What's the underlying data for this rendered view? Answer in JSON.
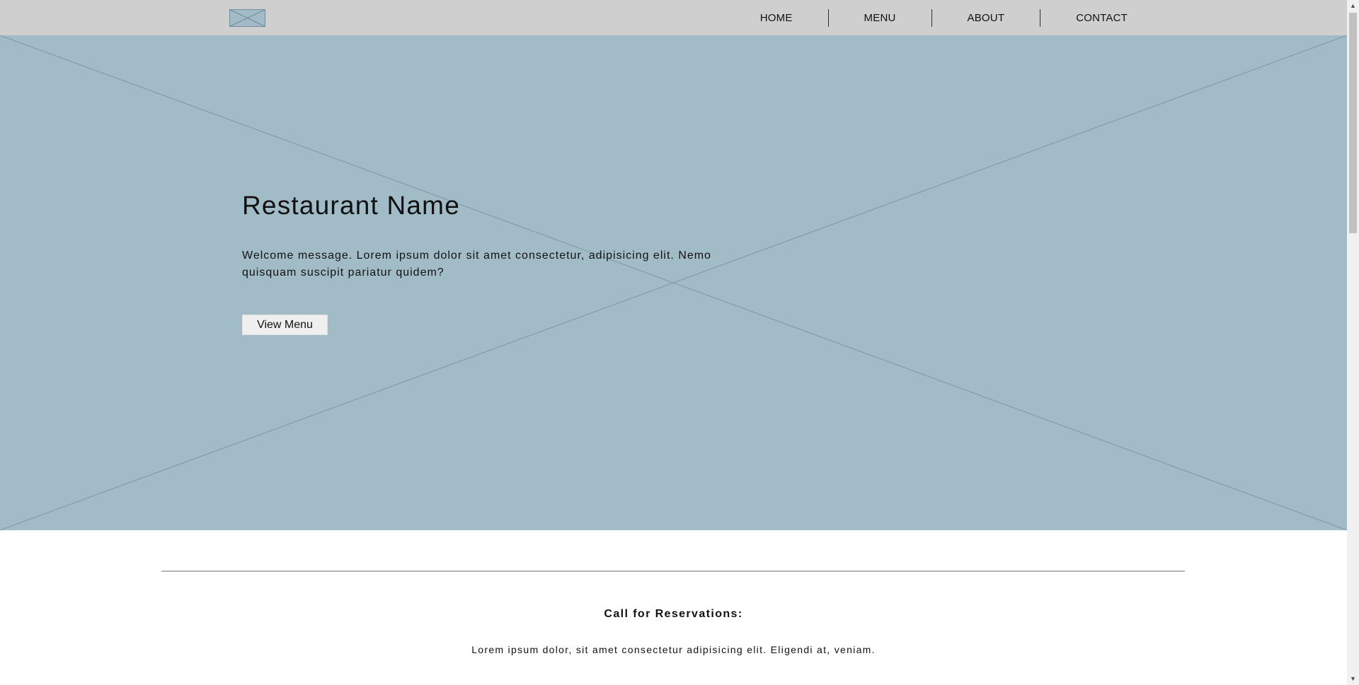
{
  "header": {
    "nav": [
      {
        "label": "HOME"
      },
      {
        "label": "MENU"
      },
      {
        "label": "ABOUT"
      },
      {
        "label": "CONTACT"
      }
    ]
  },
  "hero": {
    "title": "Restaurant Name",
    "text": "Welcome message. Lorem ipsum dolor sit amet consectetur, adipisicing elit. Nemo quisquam suscipit pariatur quidem?",
    "button_label": "View Menu",
    "background_color": "#a2bcc7"
  },
  "reservations": {
    "heading": "Call for Reservations:",
    "text": "Lorem ipsum dolor, sit amet consectetur adipisicing elit. Eligendi at, veniam."
  },
  "icons": {
    "logo": "image-placeholder-icon",
    "scroll_up": "▲",
    "scroll_down": "▼"
  }
}
